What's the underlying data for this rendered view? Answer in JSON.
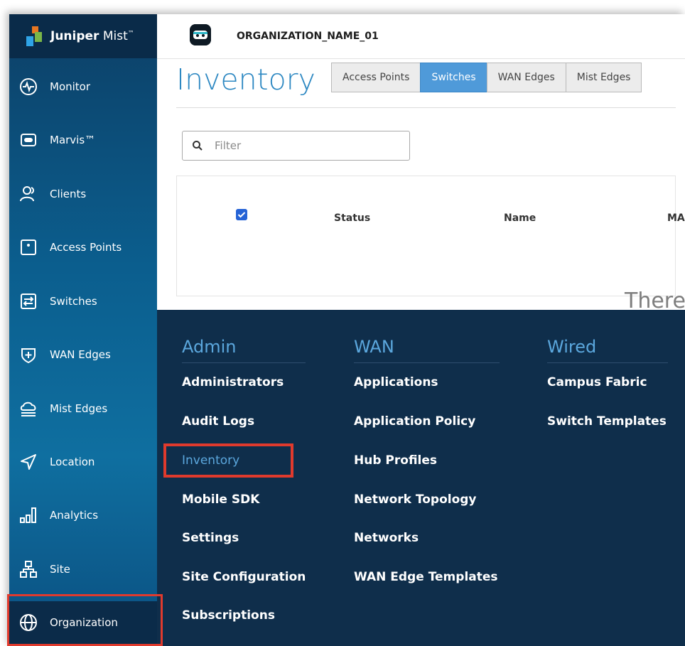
{
  "brand": {
    "name_bold": "Juniper",
    "name_light": " Mist",
    "tm": "™"
  },
  "org": {
    "name": "ORGANIZATION_NAME_01"
  },
  "sidebar": {
    "items": [
      {
        "label": "Monitor",
        "icon": "monitor-icon"
      },
      {
        "label": "Marvis™",
        "icon": "marvis-icon"
      },
      {
        "label": "Clients",
        "icon": "clients-icon"
      },
      {
        "label": "Access Points",
        "icon": "access-point-icon"
      },
      {
        "label": "Switches",
        "icon": "switch-icon"
      },
      {
        "label": "WAN Edges",
        "icon": "wan-edge-icon"
      },
      {
        "label": "Mist Edges",
        "icon": "mist-edge-icon"
      },
      {
        "label": "Location",
        "icon": "location-icon"
      },
      {
        "label": "Analytics",
        "icon": "analytics-icon"
      },
      {
        "label": "Site",
        "icon": "site-icon"
      },
      {
        "label": "Organization",
        "icon": "globe-icon"
      }
    ]
  },
  "page": {
    "title": "Inventory"
  },
  "tabs": [
    {
      "label": "Access Points",
      "active": false
    },
    {
      "label": "Switches",
      "active": true
    },
    {
      "label": "WAN Edges",
      "active": false
    },
    {
      "label": "Mist Edges",
      "active": false
    }
  ],
  "filter": {
    "placeholder": "Filter"
  },
  "table": {
    "headers": [
      "Status",
      "Name",
      "MA"
    ],
    "empty_text": "There"
  },
  "mega_menu": {
    "columns": [
      {
        "heading": "Admin",
        "items": [
          "Administrators",
          "Audit Logs",
          "Inventory",
          "Mobile SDK",
          "Settings",
          "Site Configuration",
          "Subscriptions"
        ]
      },
      {
        "heading": "WAN",
        "items": [
          "Applications",
          "Application Policy",
          "Hub Profiles",
          "Network Topology",
          "Networks",
          "WAN Edge Templates"
        ]
      },
      {
        "heading": "Wired",
        "items": [
          "Campus Fabric",
          "Switch Templates"
        ]
      }
    ],
    "selected": "Inventory"
  },
  "colors": {
    "accent": "#5ba7dd",
    "highlight": "#e03a2d",
    "active_tab": "#4f9ad9"
  }
}
